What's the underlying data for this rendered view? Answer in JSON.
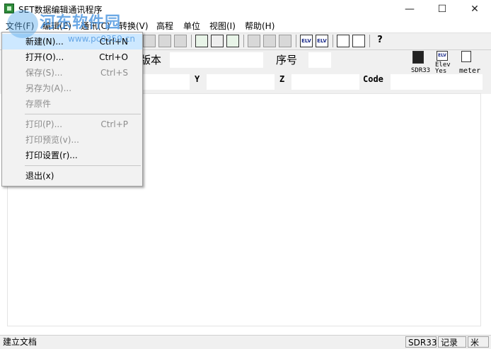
{
  "window": {
    "title": "SET数据编辑通讯程序",
    "minimize": "—",
    "maximize": "☐",
    "close": "✕"
  },
  "menubar": [
    {
      "label": "文件(F)"
    },
    {
      "label": "编辑(E)"
    },
    {
      "label": "通讯(C)"
    },
    {
      "label": "转换(V)"
    },
    {
      "label": "高程"
    },
    {
      "label": "单位"
    },
    {
      "label": "视图(I)"
    },
    {
      "label": "帮助(H)"
    }
  ],
  "file_menu": {
    "items": [
      {
        "label": "新建(N)...",
        "shortcut": "Ctrl+N",
        "enabled": true
      },
      {
        "label": "打开(O)...",
        "shortcut": "Ctrl+O",
        "enabled": true
      },
      {
        "label": "保存(S)...",
        "shortcut": "Ctrl+S",
        "enabled": false
      },
      {
        "label": "另存为(A)...",
        "shortcut": "",
        "enabled": false
      },
      {
        "label": "存原件",
        "shortcut": "",
        "enabled": false
      },
      {
        "label": "打印(P)...",
        "shortcut": "Ctrl+P",
        "enabled": false
      },
      {
        "label": "打印预览(v)...",
        "shortcut": "",
        "enabled": false
      },
      {
        "label": "打印设置(r)...",
        "shortcut": "",
        "enabled": true
      },
      {
        "label": "退出(x)",
        "shortcut": "",
        "enabled": true
      }
    ]
  },
  "toolbar": {
    "icons": [
      "new-icon",
      "open-icon",
      "save-icon",
      "cut-icon",
      "copy-icon",
      "paste-icon",
      "import-icon",
      "export-icon",
      "convert-icon",
      "grid-icon",
      "grid-x-icon",
      "calc-icon",
      "elv-icon",
      "elv-n-icon",
      "meter-icon",
      "feet-icon",
      "help-icon"
    ],
    "elv_label": "ELV",
    "help_glyph": "?"
  },
  "form": {
    "version_label": "版本",
    "serial_label": "序号",
    "y_label": "Y",
    "z_label": "Z",
    "code_label": "Code",
    "sdr_caption": "SDR33",
    "elev_caption_1": "Elev",
    "elev_caption_2": "Yes",
    "unit_caption": "meter"
  },
  "statusbar": {
    "message": "建立文档",
    "format": "SDR33",
    "record": "记录",
    "unit": "米"
  },
  "watermark": {
    "text": "河东软件园",
    "url": "www.pc0359.cn"
  },
  "colors": {
    "highlight": "#cde8ff",
    "disabled_text": "#8d8d8d",
    "watermark": "#3c8cdc"
  }
}
